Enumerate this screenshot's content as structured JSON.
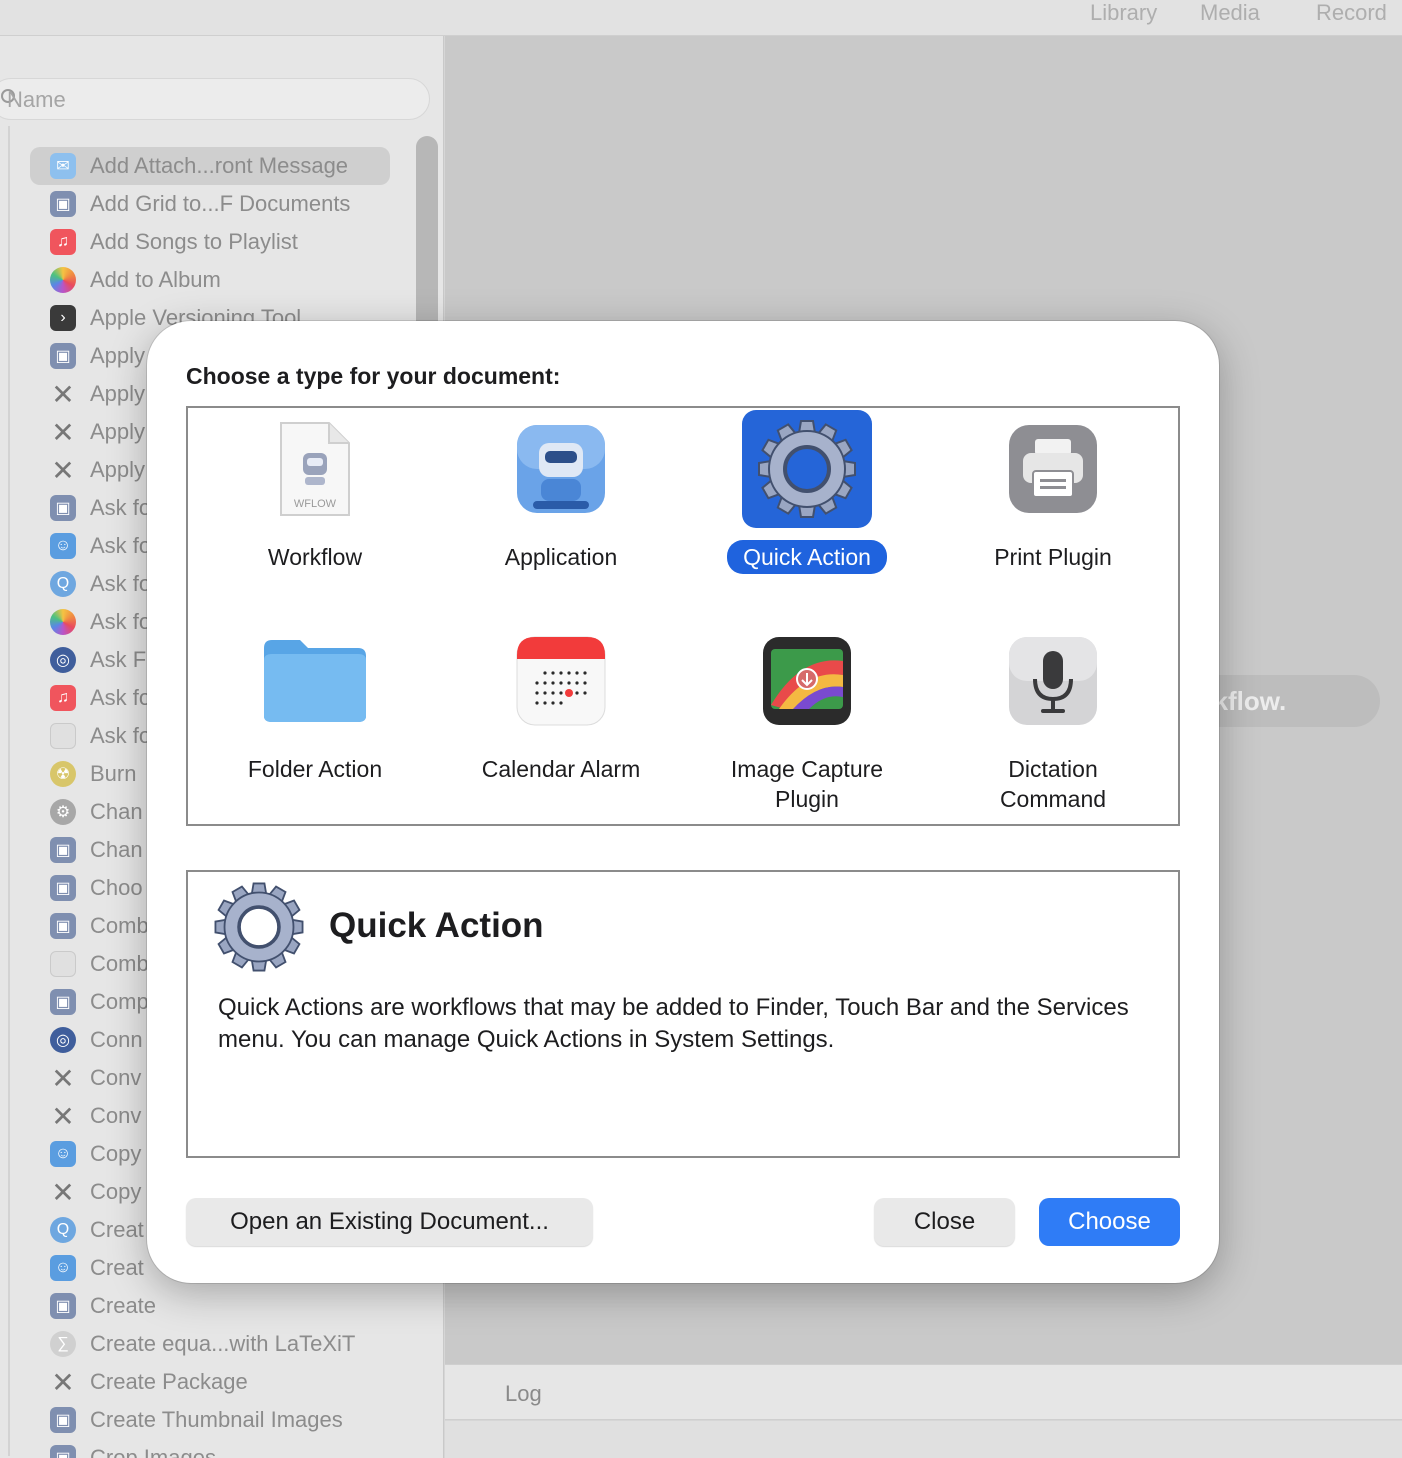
{
  "toolbar": {
    "library": "Library",
    "media": "Media",
    "record": "Record"
  },
  "sidebar": {
    "search_placeholder": "Name",
    "items": [
      {
        "label": "Add Attach...ront Message",
        "icon": "mail-icon",
        "selected": true
      },
      {
        "label": "Add Grid to...F Documents",
        "icon": "automator-icon"
      },
      {
        "label": "Add Songs to Playlist",
        "icon": "music-icon"
      },
      {
        "label": "Add to Album",
        "icon": "photos-icon"
      },
      {
        "label": "Apple Versioning Tool",
        "icon": "terminal-icon"
      },
      {
        "label": "Apply Color...file to Images",
        "icon": "automator-icon"
      },
      {
        "label": "Apply",
        "icon": "tools-icon"
      },
      {
        "label": "Apply",
        "icon": "tools-icon"
      },
      {
        "label": "Apply",
        "icon": "tools-icon"
      },
      {
        "label": "Ask fo",
        "icon": "automator-icon"
      },
      {
        "label": "Ask fo",
        "icon": "finder-icon"
      },
      {
        "label": "Ask fo",
        "icon": "quicktime-icon"
      },
      {
        "label": "Ask fo",
        "icon": "photos-icon"
      },
      {
        "label": "Ask F",
        "icon": "globe-icon"
      },
      {
        "label": "Ask fo",
        "icon": "music-icon"
      },
      {
        "label": "Ask fo",
        "icon": "blank-icon"
      },
      {
        "label": "Burn",
        "icon": "burn-icon"
      },
      {
        "label": "Chan",
        "icon": "gear-icon"
      },
      {
        "label": "Chan",
        "icon": "automator-icon"
      },
      {
        "label": "Choo",
        "icon": "automator-icon"
      },
      {
        "label": "Comb",
        "icon": "automator-icon"
      },
      {
        "label": "Comb",
        "icon": "blank-icon"
      },
      {
        "label": "Comp",
        "icon": "automator-icon"
      },
      {
        "label": "Conn",
        "icon": "globe-icon"
      },
      {
        "label": "Conv",
        "icon": "tools-icon"
      },
      {
        "label": "Conv",
        "icon": "tools-icon"
      },
      {
        "label": "Copy",
        "icon": "finder-icon"
      },
      {
        "label": "Copy",
        "icon": "tools-icon"
      },
      {
        "label": "Creat",
        "icon": "quicktime-icon"
      },
      {
        "label": "Creat",
        "icon": "finder-icon"
      },
      {
        "label": "Create",
        "icon": "automator-icon"
      },
      {
        "label": "Create equa...with LaTeXiT",
        "icon": "latex-icon"
      },
      {
        "label": "Create Package",
        "icon": "tools-icon"
      },
      {
        "label": "Create Thumbnail Images",
        "icon": "automator-icon"
      },
      {
        "label": "Crop Images",
        "icon": "automator-icon"
      }
    ]
  },
  "content": {
    "hint": "r workflow.",
    "log_label": "Log"
  },
  "dialog": {
    "title": "Choose a type for your document:",
    "types": [
      {
        "label": "Workflow",
        "icon": "workflow-document-icon",
        "badge": "WFLOW"
      },
      {
        "label": "Application",
        "icon": "automator-robot-icon"
      },
      {
        "label": "Quick Action",
        "icon": "gear-icon",
        "selected": true
      },
      {
        "label": "Print Plugin",
        "icon": "printer-icon"
      },
      {
        "label": "Folder Action",
        "icon": "folder-icon"
      },
      {
        "label": "Calendar Alarm",
        "icon": "calendar-icon"
      },
      {
        "label": "Image Capture\nPlugin",
        "icon": "image-capture-icon"
      },
      {
        "label": "Dictation\nCommand",
        "icon": "microphone-icon"
      }
    ],
    "description": {
      "title": "Quick Action",
      "text": "Quick Actions are workflows that may be added to Finder, Touch Bar and the Services menu. You can manage Quick Actions in System Settings."
    },
    "buttons": {
      "open": "Open an Existing Document...",
      "close": "Close",
      "choose": "Choose"
    },
    "colors": {
      "selection": "#1f63de",
      "primary_button": "#2f7cf6"
    }
  }
}
